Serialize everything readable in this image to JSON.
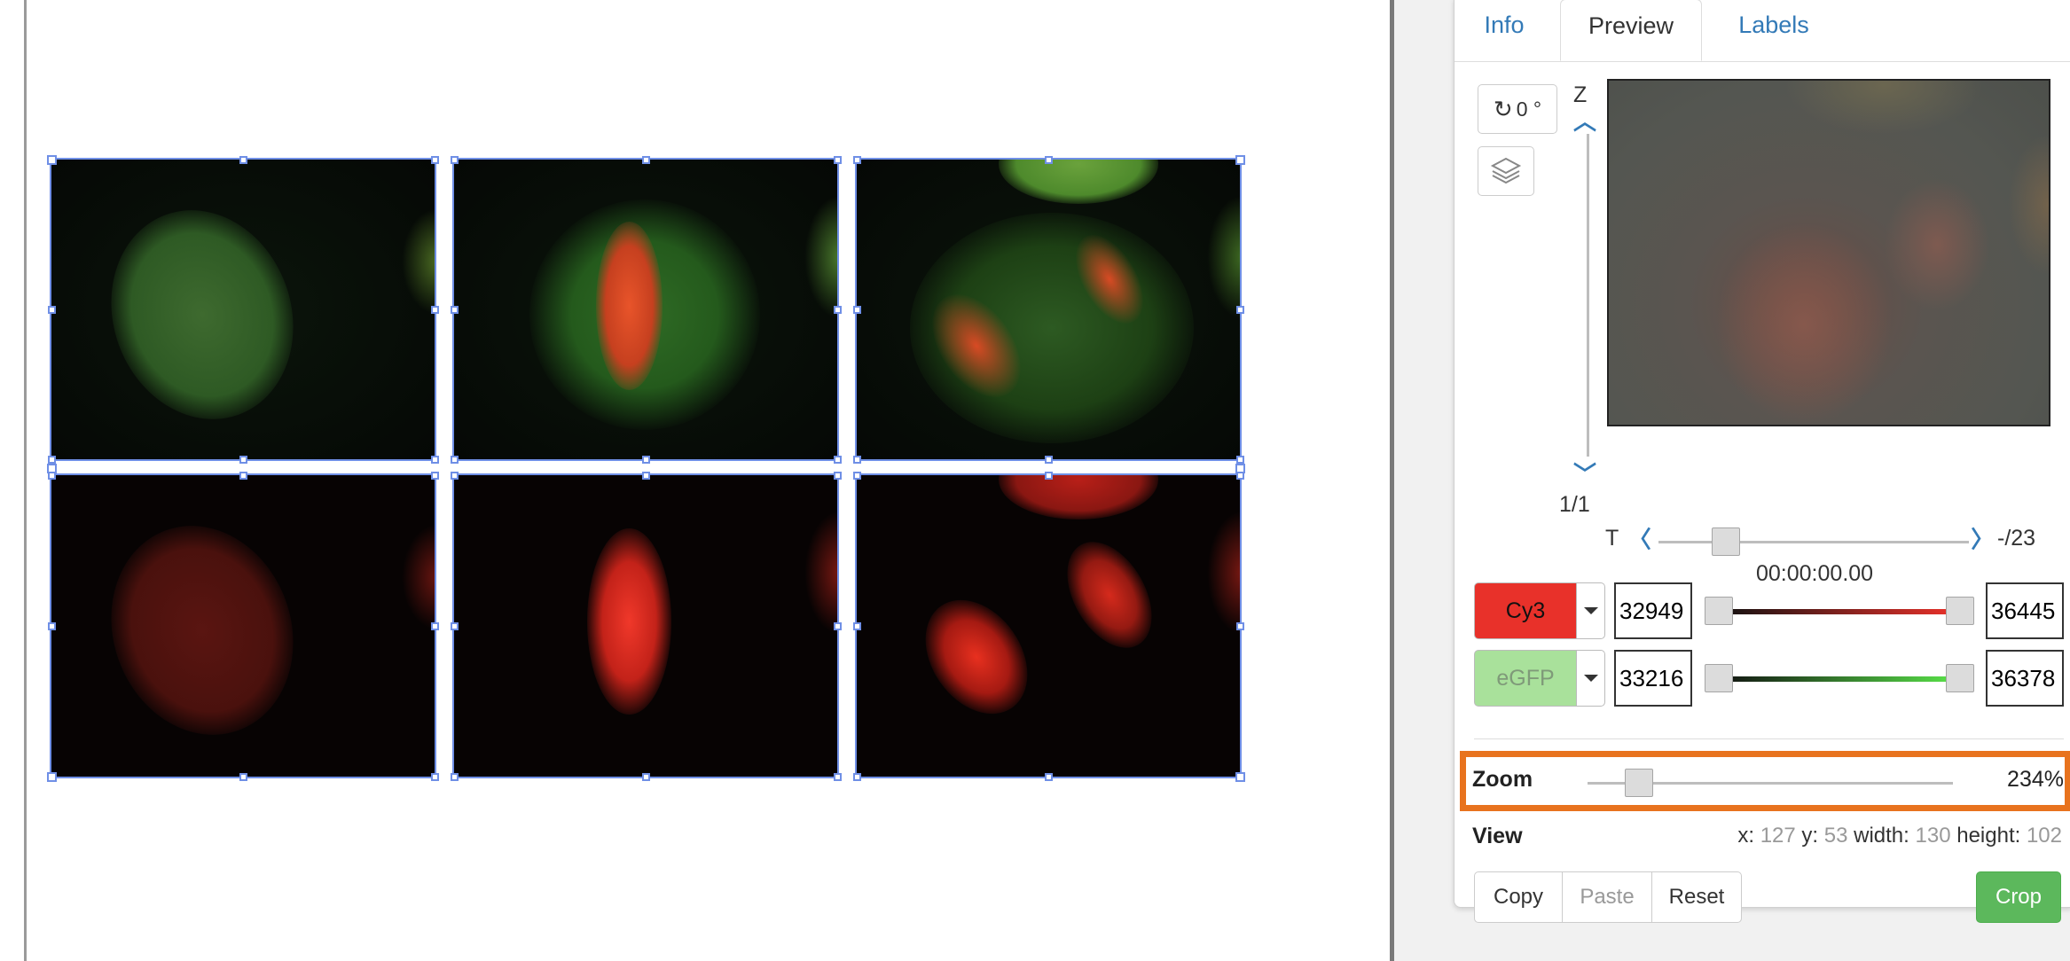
{
  "tabs": [
    {
      "label": "Info",
      "active": false
    },
    {
      "label": "Preview",
      "active": true
    },
    {
      "label": "Labels",
      "active": false
    }
  ],
  "rotation": {
    "value": "0 °"
  },
  "z_axis": {
    "label": "Z",
    "counter": "1/1"
  },
  "t_axis": {
    "label": "T",
    "counter": "-/23",
    "time": "00:00:00.00"
  },
  "channels": [
    {
      "name": "Cy3",
      "min": "32949",
      "max": "36445",
      "color": "#e8312a",
      "active": true
    },
    {
      "name": "eGFP",
      "min": "33216",
      "max": "36378",
      "color": "#a9e19b",
      "active": false
    }
  ],
  "zoom": {
    "label": "Zoom",
    "value": "234%",
    "fraction": 0.11
  },
  "view": {
    "label": "View",
    "x_label": "x:",
    "x": "127",
    "y_label": "y:",
    "y": "53",
    "width_label": "width:",
    "width": "130",
    "height_label": "height:",
    "height": "102"
  },
  "buttons": {
    "copy": "Copy",
    "paste": "Paste",
    "reset": "Reset",
    "crop": "Crop"
  },
  "colors": {
    "accent": "#337ab7",
    "selection": "#6f8fe6",
    "highlight": "#e8731e",
    "crop": "#5cb85c"
  }
}
